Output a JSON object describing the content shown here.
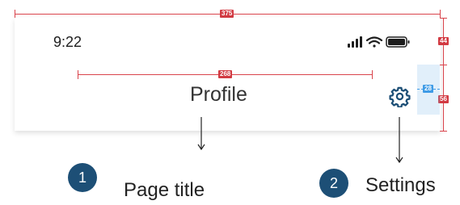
{
  "status_bar": {
    "time": "9:22",
    "icons": [
      "signal-icon",
      "wifi-icon",
      "battery-icon"
    ]
  },
  "header": {
    "title": "Profile",
    "action_icon": "gear-icon"
  },
  "measurements": {
    "screen_width": "375",
    "title_width": "268",
    "status_bar_height": "44",
    "header_height": "56",
    "icon_size": "28"
  },
  "callouts": [
    {
      "number": "1",
      "label": "Page title"
    },
    {
      "number": "2",
      "label": "Settings"
    }
  ],
  "colors": {
    "spec_red": "#d23a42",
    "spec_blue": "#3e9be6",
    "callout_blue": "#1d4f76",
    "icon_blue": "#1d4f76"
  }
}
